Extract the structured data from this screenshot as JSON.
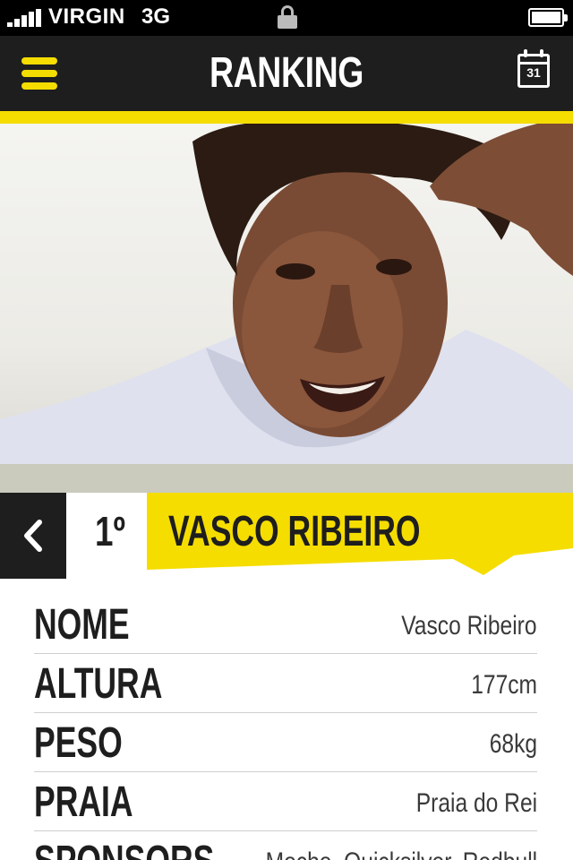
{
  "status_bar": {
    "carrier": "VIRGIN",
    "network": "3G"
  },
  "nav": {
    "title": "RANKING",
    "calendar_day": "31"
  },
  "colors": {
    "accent": "#f5dd00",
    "dark": "#1e1e1e"
  },
  "athlete": {
    "rank": "1º",
    "name": "VASCO RIBEIRO"
  },
  "details": [
    {
      "label": "NOME",
      "value": "Vasco Ribeiro"
    },
    {
      "label": "ALTURA",
      "value": "177cm"
    },
    {
      "label": "PESO",
      "value": "68kg"
    },
    {
      "label": "PRAIA",
      "value": "Praia do Rei"
    },
    {
      "label": "SPONSORS",
      "value": "Mocho, Quicksilver, Redbull"
    }
  ]
}
